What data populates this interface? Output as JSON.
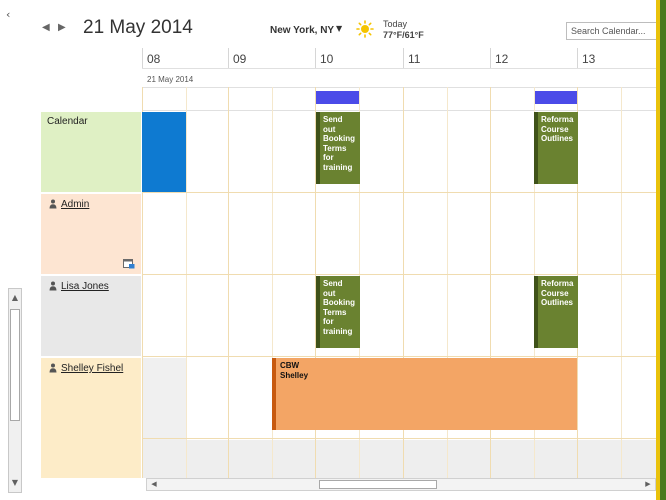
{
  "header": {
    "date_title": "21 May 2014",
    "location": "New York, NY",
    "weather_label": "Today",
    "weather_temp": "77°F/61°F",
    "search_placeholder": "Search Calendar..."
  },
  "grid": {
    "hours": [
      "08",
      "09",
      "10",
      "11",
      "12",
      "13"
    ],
    "date_row_label": "21 May 2014"
  },
  "rows": [
    {
      "label": "Calendar",
      "type": "calendar",
      "color": "#dff0c4"
    },
    {
      "label": "Admin",
      "type": "user",
      "color": "#fde5d2"
    },
    {
      "label": "Lisa Jones",
      "type": "user",
      "color": "#e8e8e8"
    },
    {
      "label": "Shelley Fishel",
      "type": "user",
      "color": "#fdecc8"
    }
  ],
  "appointments": {
    "send_out_1": {
      "lines": [
        "Send",
        "out",
        "Booking",
        "Terms",
        "for",
        "training"
      ]
    },
    "reformat_1": {
      "lines": [
        "Reforma",
        "Course",
        "Outlines"
      ]
    },
    "send_out_2": {
      "lines": [
        "Send",
        "out",
        "Booking",
        "Terms",
        "for",
        "training"
      ]
    },
    "reformat_2": {
      "lines": [
        "Reforma",
        "Course",
        "Outlines"
      ]
    },
    "cbw": {
      "title": "CBW",
      "subtitle": "Shelley"
    }
  },
  "colors": {
    "appointment_green": "#6a8230",
    "appointment_blue": "#0e7ad1",
    "appointment_orange": "#f3a565",
    "busy_indicator": "#4b4be8",
    "accent": "#e9c20c"
  },
  "icons": {
    "weather": "sun-icon",
    "search": "magnifier-icon",
    "user": "person-icon",
    "admin_badge": "calendar-share-icon"
  }
}
